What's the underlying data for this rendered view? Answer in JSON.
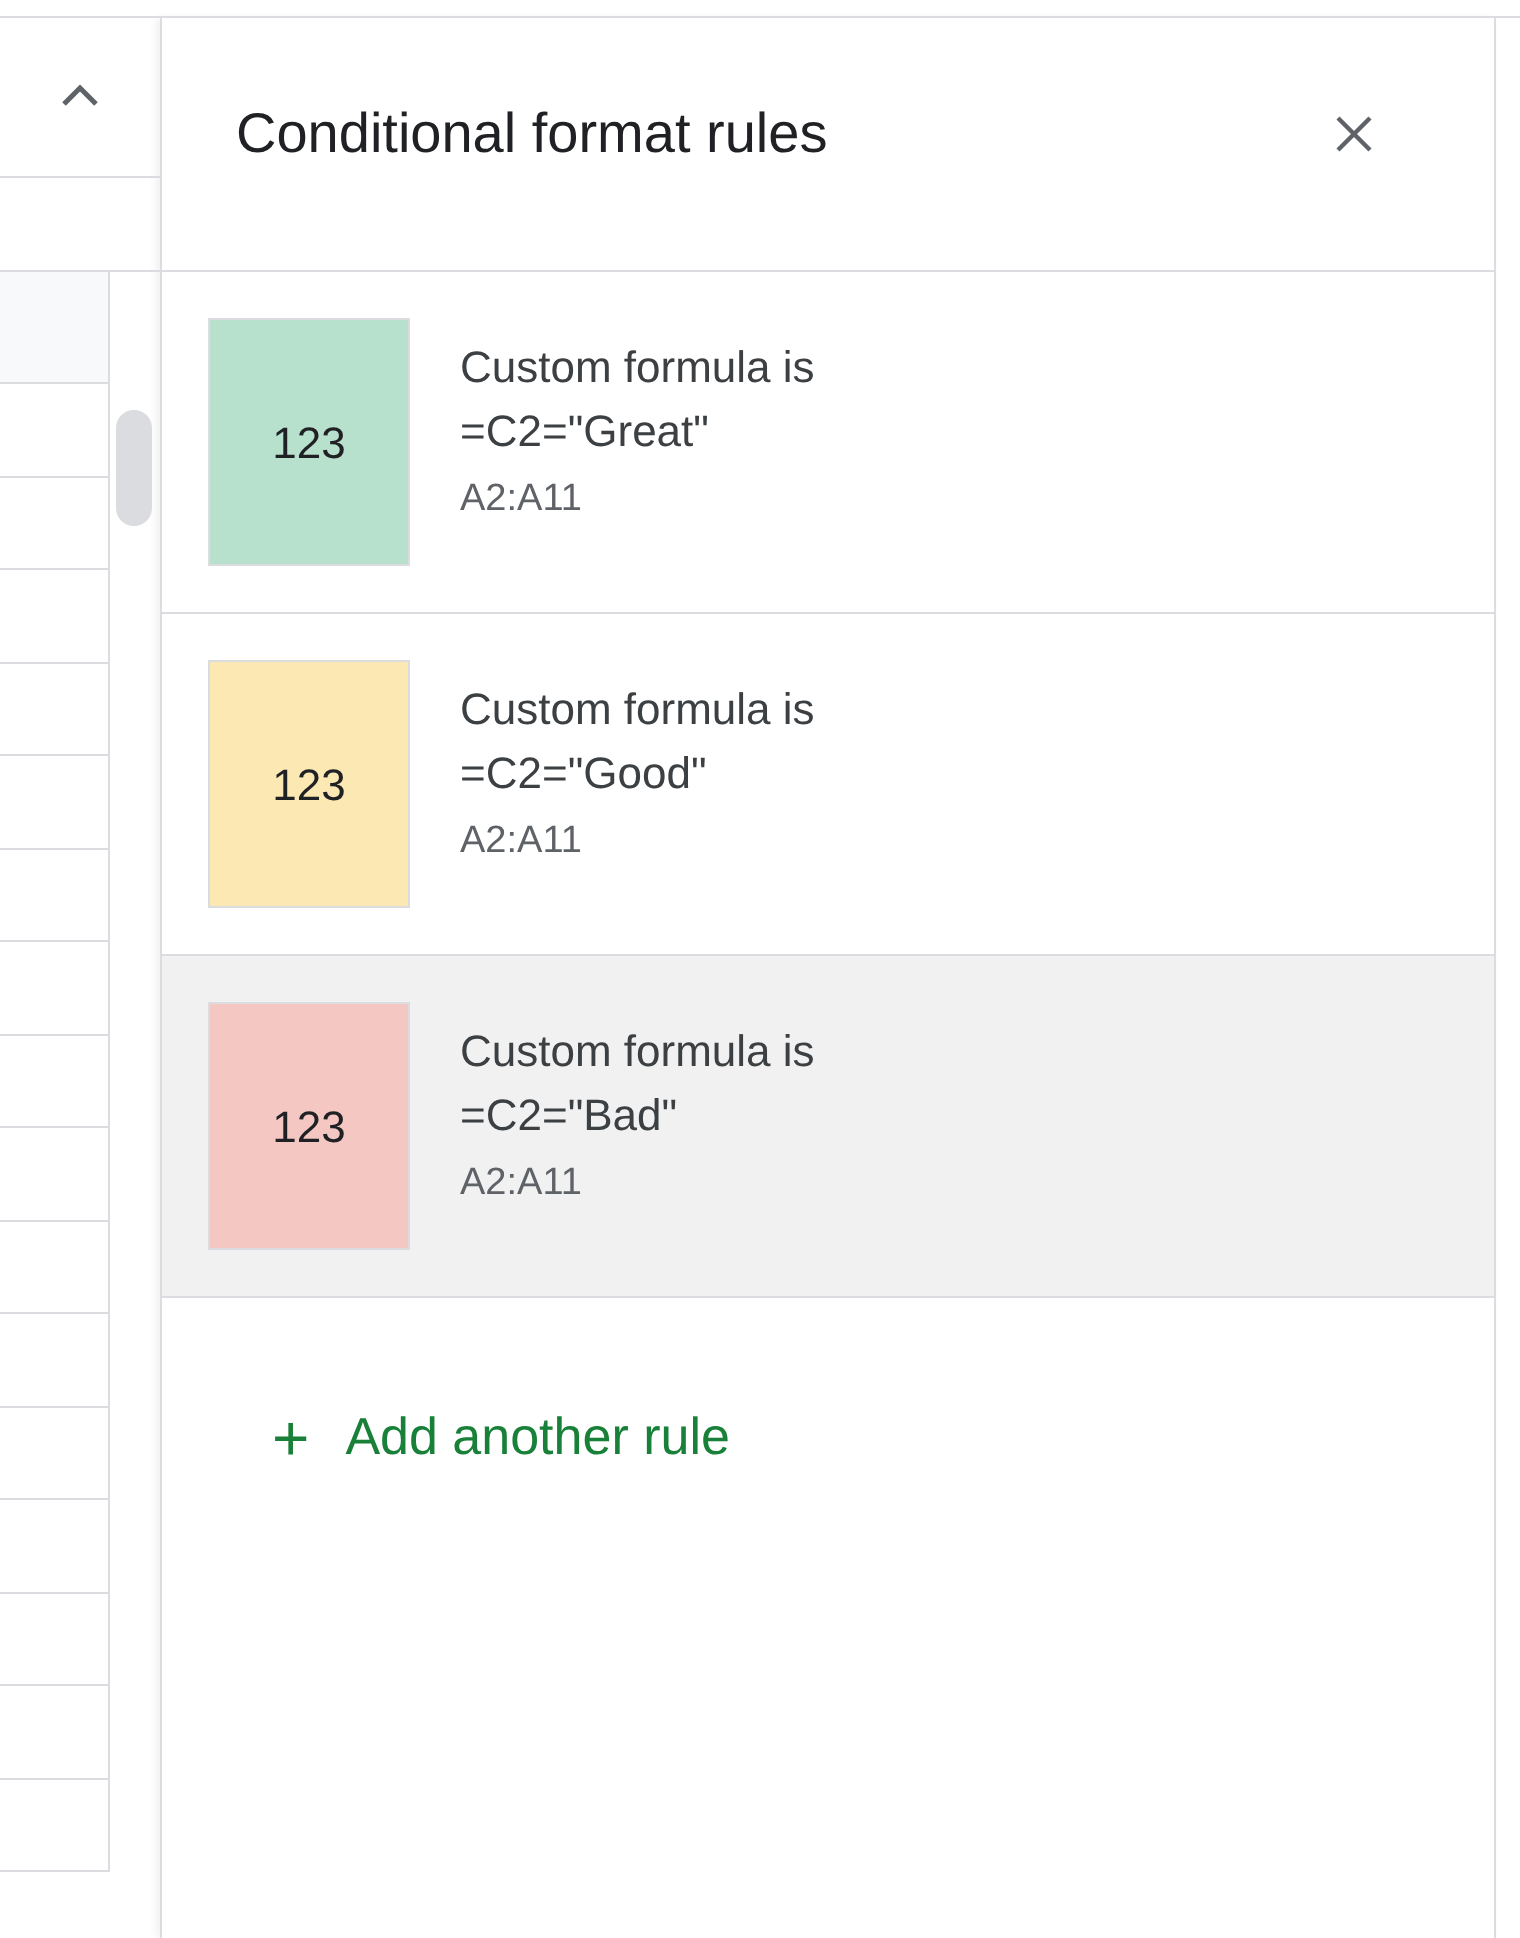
{
  "panel": {
    "title": "Conditional format rules"
  },
  "rules": [
    {
      "condition": "Custom formula is",
      "formula": "=C2=\"Great\"",
      "range": "A2:A11",
      "preview": "123",
      "color": "#b7e1cd",
      "selected": false
    },
    {
      "condition": "Custom formula is",
      "formula": "=C2=\"Good\"",
      "range": "A2:A11",
      "preview": "123",
      "color": "#fce8b2",
      "selected": false
    },
    {
      "condition": "Custom formula is",
      "formula": "=C2=\"Bad\"",
      "range": "A2:A11",
      "preview": "123",
      "color": "#f4c7c3",
      "selected": true
    }
  ],
  "add_rule": {
    "icon": "+",
    "label": "Add another rule"
  }
}
